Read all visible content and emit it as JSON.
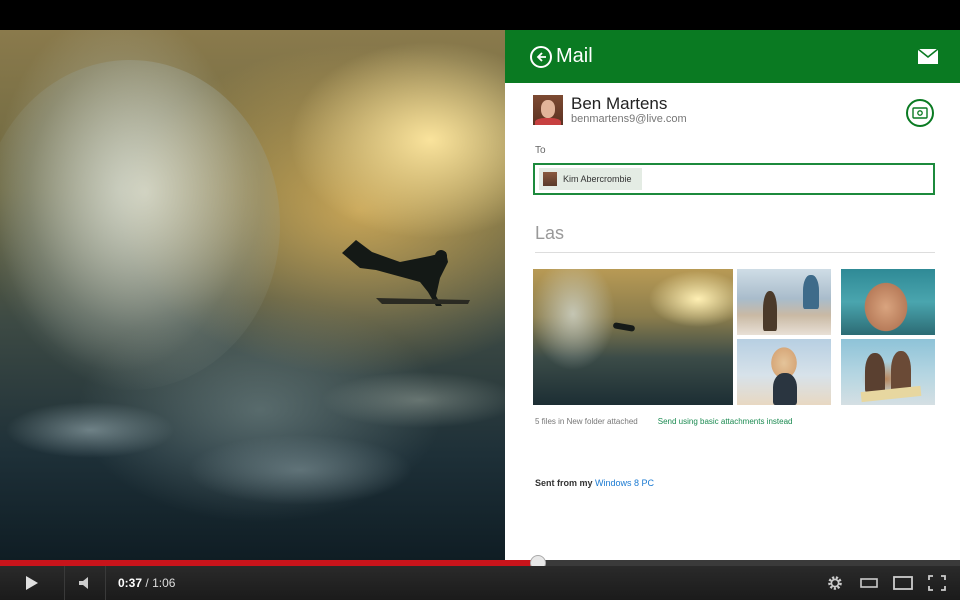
{
  "mail": {
    "title": "Mail",
    "sender": {
      "name": "Ben Martens",
      "email": "benmartens9@live.com"
    },
    "to_label": "To",
    "recipient": "Kim Abercrombie",
    "subject_value": "Las",
    "attachments": {
      "info": "5 files in New folder attached",
      "link": "Send using basic attachments instead"
    },
    "signature": {
      "prefix": "Sent from my",
      "link": "Windows 8 PC"
    },
    "accent_color": "#0a7a22"
  },
  "player": {
    "current_time": "0:37",
    "separator": "/",
    "duration": "1:06",
    "progress_fraction": 0.56,
    "progress_color": "#c8141b"
  },
  "icons": [
    "back-icon",
    "envelope-icon",
    "money-icon",
    "play-icon",
    "volume-icon",
    "settings-icon",
    "small-player-icon",
    "large-player-icon",
    "fullscreen-icon"
  ]
}
